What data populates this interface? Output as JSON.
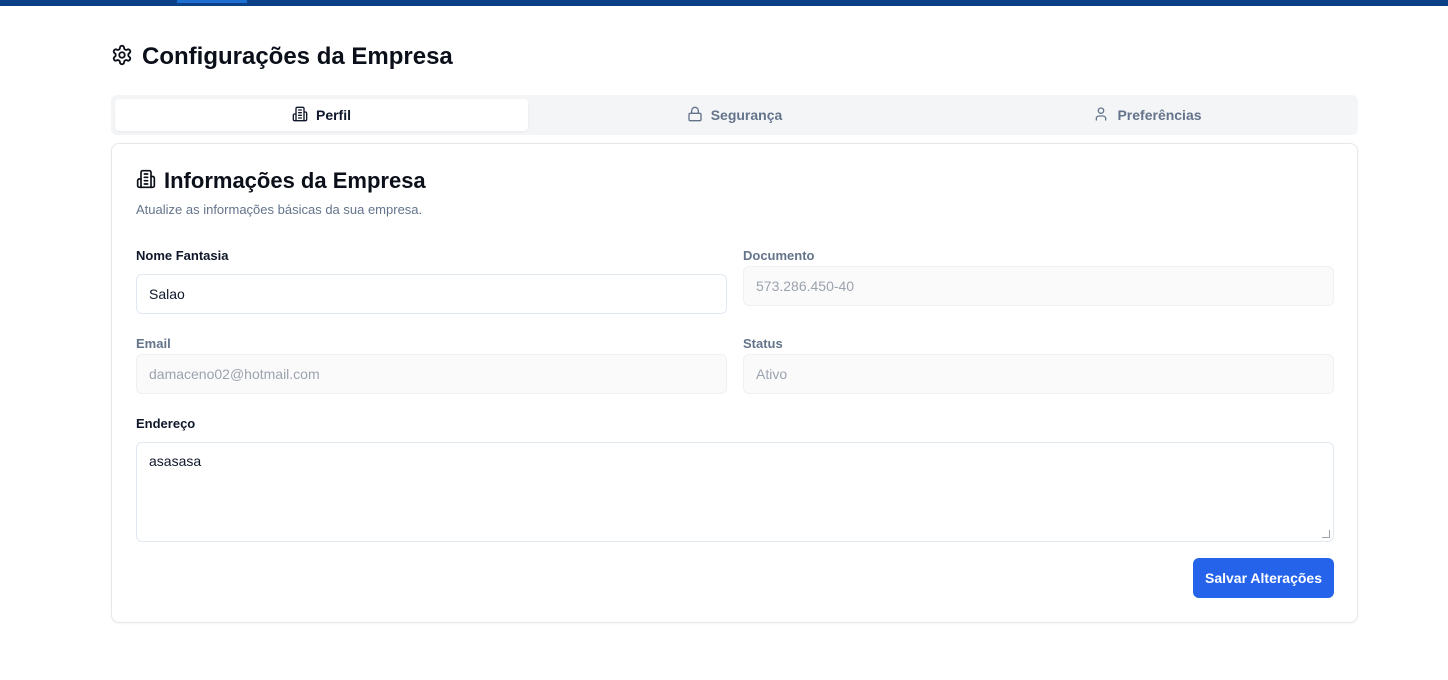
{
  "page": {
    "title": "Configurações da Empresa",
    "title_icon": "gear-icon"
  },
  "tabs": [
    {
      "label": "Perfil",
      "icon": "building-icon",
      "active": true
    },
    {
      "label": "Segurança",
      "icon": "lock-icon",
      "active": false
    },
    {
      "label": "Preferências",
      "icon": "user-icon",
      "active": false
    }
  ],
  "card": {
    "title": "Informações da Empresa",
    "icon": "building-icon",
    "description": "Atualize as informações básicas da sua empresa."
  },
  "form": {
    "nome_fantasia": {
      "label": "Nome Fantasia",
      "value": "Salao"
    },
    "documento": {
      "label": "Documento",
      "value": "573.286.450-40"
    },
    "email": {
      "label": "Email",
      "value": "damaceno02@hotmail.com"
    },
    "status": {
      "label": "Status",
      "value": "Ativo"
    },
    "endereco": {
      "label": "Endereço",
      "value": "asasasa"
    },
    "save_label": "Salvar Alterações"
  },
  "colors": {
    "primary": "#2563eb",
    "topbar": "#0b3f86"
  }
}
